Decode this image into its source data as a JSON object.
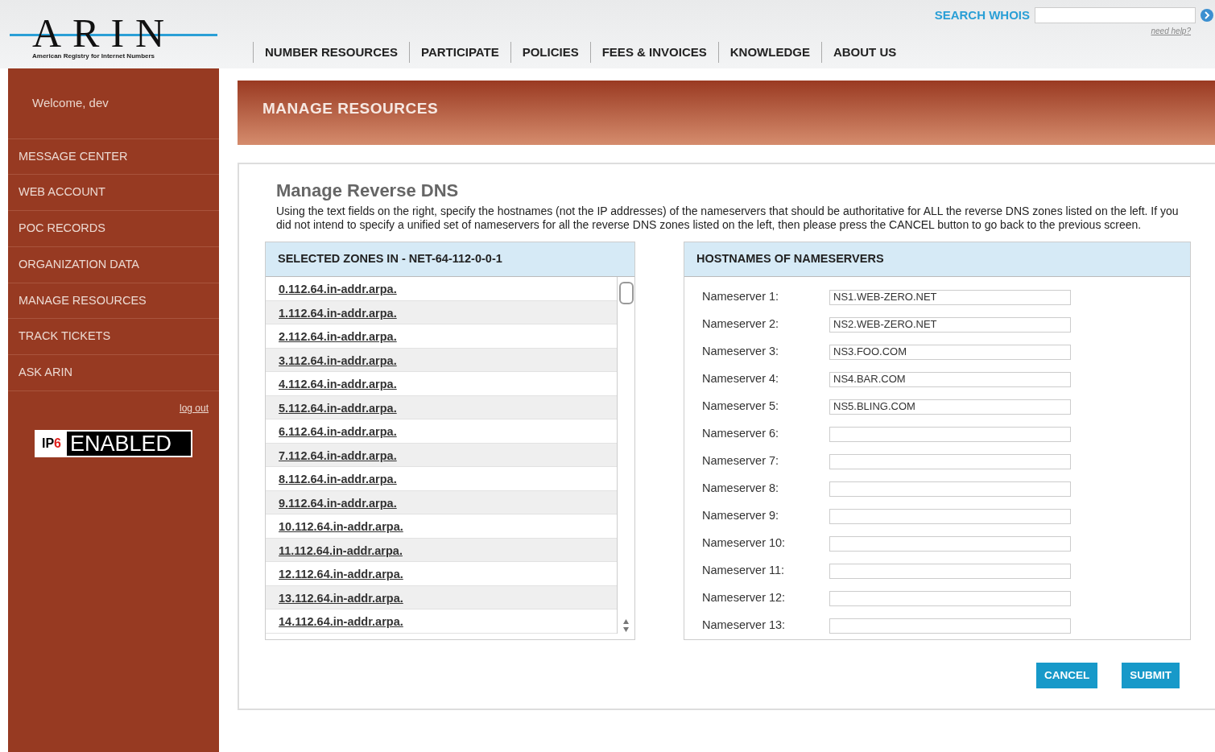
{
  "logo": {
    "name": "ARIN",
    "tagline": "American Registry for Internet Numbers"
  },
  "search": {
    "label": "SEARCH WHOIS",
    "help": "need help?"
  },
  "nav": [
    "NUMBER RESOURCES",
    "PARTICIPATE",
    "POLICIES",
    "FEES & INVOICES",
    "KNOWLEDGE",
    "ABOUT US"
  ],
  "sidebar": {
    "welcome": "Welcome, dev",
    "items": [
      "MESSAGE CENTER",
      "WEB ACCOUNT",
      "POC RECORDS",
      "ORGANIZATION DATA",
      "MANAGE RESOURCES",
      "TRACK TICKETS",
      "ASK ARIN"
    ],
    "logout": "log out",
    "badge": {
      "ip": "IP",
      "six": "6",
      "label": "ENABLED"
    }
  },
  "banner": "MANAGE RESOURCES",
  "title": "Manage Reverse DNS",
  "intro": "Using the text fields on the right, specify the hostnames (not the IP addresses) of the nameservers that should be authoritative for ALL the reverse DNS zones listed on the left. If you did not intend to specify a unified set of nameservers for all the reverse DNS zones listed on the left, then please press the CANCEL button to go back to the previous screen.",
  "zones": {
    "heading": "SELECTED ZONES IN - NET-64-112-0-0-1",
    "rows": [
      "0.112.64.in-addr.arpa.",
      "1.112.64.in-addr.arpa.",
      "2.112.64.in-addr.arpa.",
      "3.112.64.in-addr.arpa.",
      "4.112.64.in-addr.arpa.",
      "5.112.64.in-addr.arpa.",
      "6.112.64.in-addr.arpa.",
      "7.112.64.in-addr.arpa.",
      "8.112.64.in-addr.arpa.",
      "9.112.64.in-addr.arpa.",
      "10.112.64.in-addr.arpa.",
      "11.112.64.in-addr.arpa.",
      "12.112.64.in-addr.arpa.",
      "13.112.64.in-addr.arpa.",
      "14.112.64.in-addr.arpa."
    ]
  },
  "nameservers": {
    "heading": "HOSTNAMES OF NAMESERVERS",
    "fields": [
      {
        "label": "Nameserver 1:",
        "value": "NS1.WEB-ZERO.NET"
      },
      {
        "label": "Nameserver 2:",
        "value": "NS2.WEB-ZERO.NET"
      },
      {
        "label": "Nameserver 3:",
        "value": "NS3.FOO.COM"
      },
      {
        "label": "Nameserver 4:",
        "value": "NS4.BAR.COM"
      },
      {
        "label": "Nameserver 5:",
        "value": "NS5.BLING.COM"
      },
      {
        "label": "Nameserver 6:"
      },
      {
        "label": "Nameserver 7:"
      },
      {
        "label": "Nameserver 8:"
      },
      {
        "label": "Nameserver 9:"
      },
      {
        "label": "Nameserver 10:"
      },
      {
        "label": "Nameserver 11:"
      },
      {
        "label": "Nameserver 12:"
      },
      {
        "label": "Nameserver 13:"
      }
    ]
  },
  "buttons": [
    "CANCEL",
    "SUBMIT"
  ]
}
